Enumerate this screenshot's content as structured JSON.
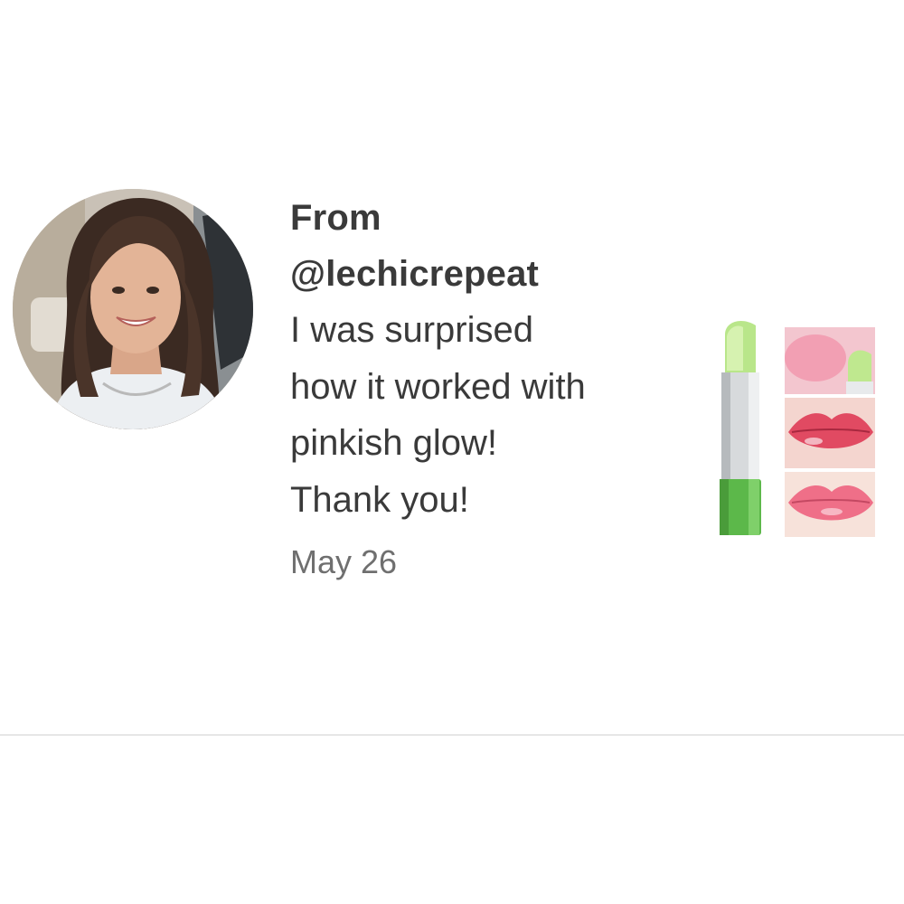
{
  "review": {
    "author_prefix": "From",
    "author_handle": "@lechicrepeat",
    "message": "I was surprised how it worked with pinkish glow! Thank you!",
    "date": "May 26"
  },
  "colors": {
    "text": "#3a3a3a",
    "date": "#6f6f6f",
    "divider": "#e6e6e6",
    "lipstick_green": "#5cb84a",
    "lip_pink": "#e85a78"
  },
  "icons": {
    "avatar": "user-photo-avatar",
    "product": "lipstick-product-thumbnail"
  }
}
